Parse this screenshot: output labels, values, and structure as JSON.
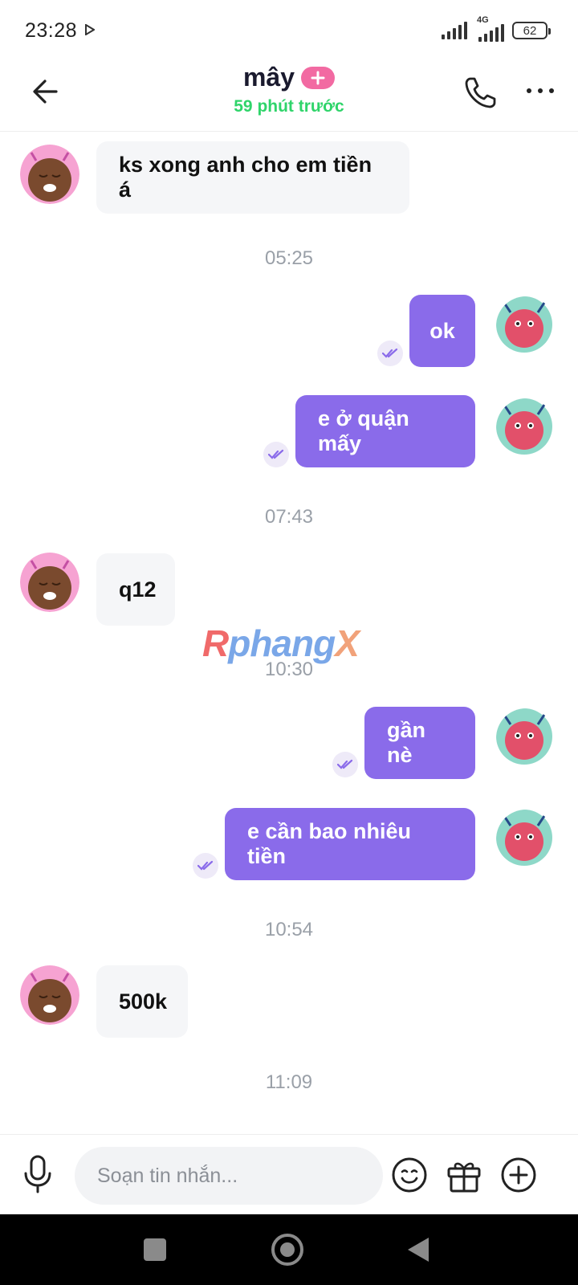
{
  "status_bar": {
    "time": "23:28",
    "network_label": "4G",
    "battery": "62"
  },
  "header": {
    "title": "mây",
    "subtitle": "59 phút trước",
    "accent_color": "#2fd46a",
    "badge_color": "#f26aa2",
    "icons": [
      "back-arrow-icon",
      "plus-icon",
      "phone-icon",
      "more-icon"
    ]
  },
  "messages": [
    {
      "from": "them",
      "text": "ks xong anh cho em tiền á"
    },
    {
      "timestamp": "05:25"
    },
    {
      "from": "me",
      "text": "ok"
    },
    {
      "from": "me",
      "text": "e ở quận mấy"
    },
    {
      "timestamp": "07:43"
    },
    {
      "from": "them",
      "text": "q12"
    },
    {
      "timestamp": "10:30"
    },
    {
      "from": "me",
      "text": "gần nè"
    },
    {
      "from": "me",
      "text": "e cần bao nhiêu tiền"
    },
    {
      "timestamp": "10:54"
    },
    {
      "from": "them",
      "text": "500k"
    },
    {
      "timestamp": "11:09"
    }
  ],
  "timestamps": [
    "05:25",
    "07:43",
    "10:30",
    "10:54",
    "11:09"
  ],
  "outgoing_bubble_color": "#8a6bea",
  "watermark": {
    "part1": "R",
    "part2": "phang",
    "part3": "X"
  },
  "composer": {
    "placeholder": "Soạn tin nhắn...",
    "icons": [
      "microphone-icon",
      "emoji-icon",
      "gift-icon",
      "add-icon"
    ]
  }
}
